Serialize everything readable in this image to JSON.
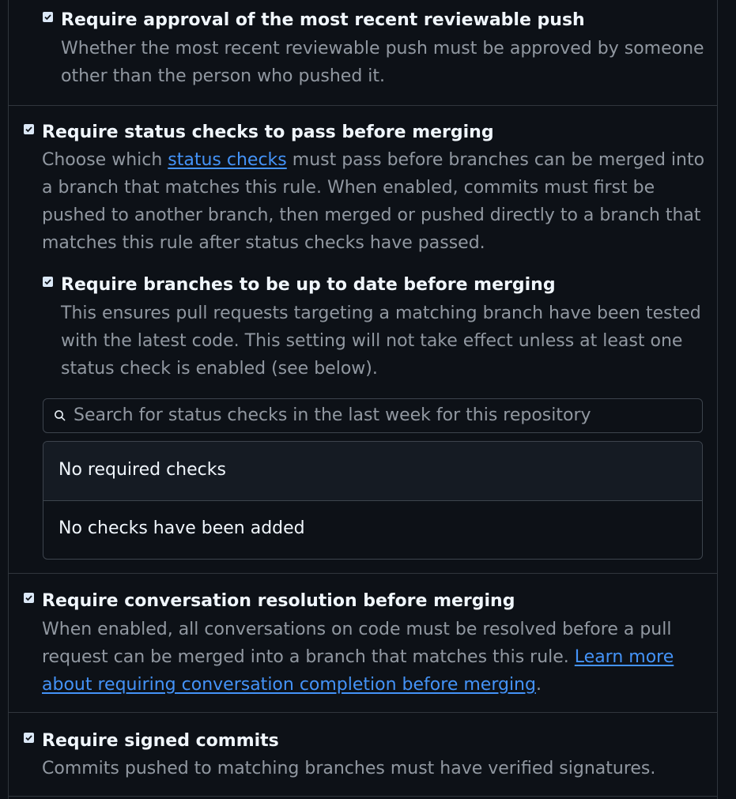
{
  "sections": {
    "push_approval": {
      "title": "Require approval of the most recent reviewable push",
      "desc_lines": [
        "Whether the most recent reviewable push must be approved by someone",
        "other than the person who pushed it."
      ],
      "checked": true
    },
    "status_checks": {
      "title": "Require status checks to pass before merging",
      "desc_line1_prefix": "Choose which ",
      "desc_line1_link": "status checks",
      "desc_line1_suffix": " must pass before branches can be merged into",
      "desc_lines_rest": [
        "a branch that matches this rule. When enabled, commits must first be",
        "pushed to another branch, then merged or pushed directly to a branch that",
        "matches this rule after status checks have passed."
      ],
      "checked": true,
      "up_to_date": {
        "title": "Require branches to be up to date before merging",
        "desc_lines": [
          "This ensures pull requests targeting a matching branch have been tested",
          "with the latest code. This setting will not take effect unless at least one",
          "status check is enabled (see below)."
        ],
        "checked": true
      },
      "search": {
        "placeholder": "Search for status checks in the last week for this repository",
        "icon": "search-icon"
      },
      "required_checks_header": "No required checks",
      "empty_message": "No checks have been added"
    },
    "conversation_resolution": {
      "title": "Require conversation resolution before merging",
      "desc_line1": "When enabled, all conversations on code must be resolved before a pull",
      "desc_line2_prefix": "request can be merged into a branch that matches this rule. ",
      "desc_line2_link": "Learn more",
      "desc_line3_link": "about requiring conversation completion before merging",
      "desc_line3_suffix": ".",
      "checked": true
    },
    "signed_commits": {
      "title": "Require signed commits",
      "desc_lines": [
        "Commits pushed to matching branches must have verified signatures."
      ],
      "checked": true
    }
  },
  "colors": {
    "background": "#0d1117",
    "border": "#30363d",
    "link": "#4493f8",
    "muted_text": "#9198a1",
    "checkbox": "#dbe8f7"
  }
}
